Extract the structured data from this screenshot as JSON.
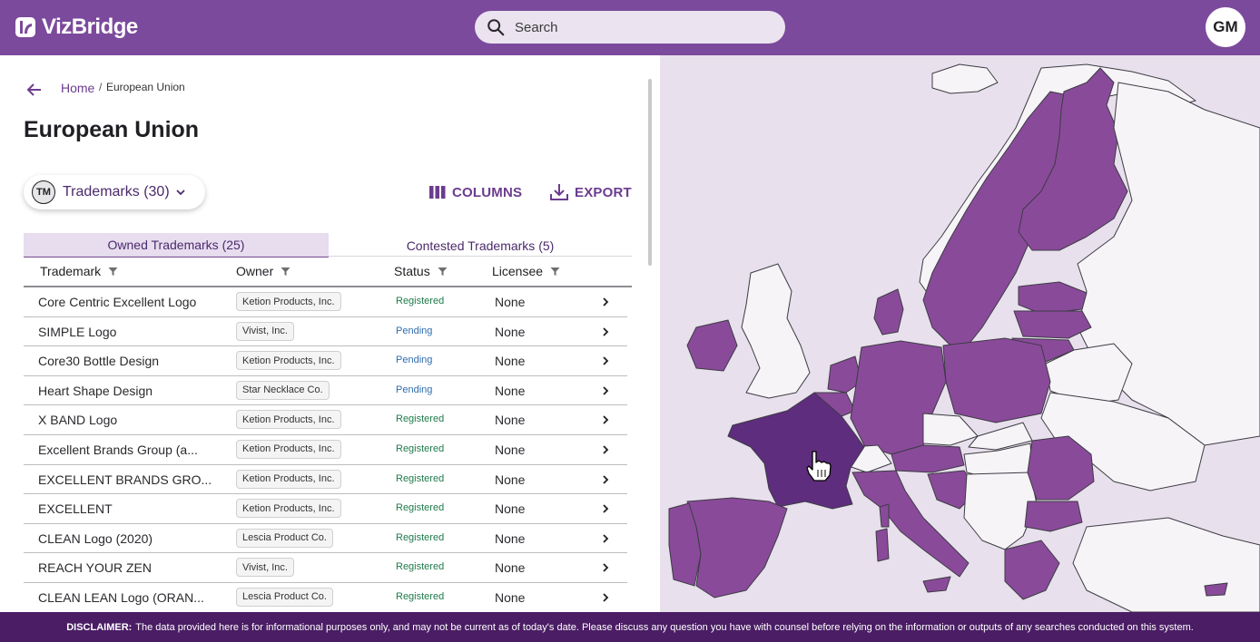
{
  "app": {
    "brand": "VizBridge",
    "user_initials": "GM"
  },
  "search": {
    "placeholder": "Search"
  },
  "breadcrumb": {
    "home": "Home",
    "separator": "/",
    "current": "European Union"
  },
  "page": {
    "title": "European Union"
  },
  "asset_selector": {
    "badge": "TM",
    "label": "Trademarks (30)"
  },
  "toolbar": {
    "columns_label": "COLUMNS",
    "export_label": "EXPORT"
  },
  "tabs": [
    {
      "label": "Owned Trademarks (25)",
      "active": true
    },
    {
      "label": "Contested Trademarks (5)",
      "active": false
    }
  ],
  "columns": [
    "Trademark",
    "Owner",
    "Status",
    "Licensee"
  ],
  "rows": [
    {
      "name": "Core Centric Excellent Logo",
      "owner": "Ketion Products, Inc.",
      "status": "Registered",
      "licensee": "None"
    },
    {
      "name": "SIMPLE Logo",
      "owner": "Vivist, Inc.",
      "status": "Pending",
      "licensee": "None"
    },
    {
      "name": "Core30 Bottle Design",
      "owner": "Ketion Products, Inc.",
      "status": "Pending",
      "licensee": "None"
    },
    {
      "name": "Heart Shape Design",
      "owner": "Star Necklace Co.",
      "status": "Pending",
      "licensee": "None"
    },
    {
      "name": "X BAND Logo",
      "owner": "Ketion Products, Inc.",
      "status": "Registered",
      "licensee": "None"
    },
    {
      "name": "Excellent Brands Group (a...",
      "owner": "Ketion Products, Inc.",
      "status": "Registered",
      "licensee": "None"
    },
    {
      "name": "EXCELLENT BRANDS GRO...",
      "owner": "Ketion Products, Inc.",
      "status": "Registered",
      "licensee": "None"
    },
    {
      "name": "EXCELLENT",
      "owner": "Ketion Products, Inc.",
      "status": "Registered",
      "licensee": "None"
    },
    {
      "name": "CLEAN Logo (2020)",
      "owner": "Lescia Product Co.",
      "status": "Registered",
      "licensee": "None"
    },
    {
      "name": "REACH YOUR ZEN",
      "owner": "Vivist, Inc.",
      "status": "Registered",
      "licensee": "None"
    },
    {
      "name": "CLEAN LEAN Logo (ORAN...",
      "owner": "Lescia Product Co.",
      "status": "Registered",
      "licensee": "None"
    }
  ],
  "map": {
    "highlighted_country": "France",
    "colors": {
      "sea": "#e8e0ec",
      "member": "#8a4a9a",
      "selected": "#5e2d7e",
      "non_member": "#f6f4f7",
      "border": "#3c3c44"
    }
  },
  "disclaimer": {
    "label": "DISCLAIMER:",
    "text": "The data provided here is for informational purposes only, and may not be current as of today's date. Please discuss any question you have with counsel before relying on the information or outputs of any searches conducted on this system."
  },
  "colors": {
    "brand": "#7b4a9c",
    "footer": "#4a1d64",
    "registered": "#1e7a4a",
    "pending": "#2f6cae"
  },
  "icons": {
    "logo": "vizbridge-logo-icon",
    "search": "search-icon",
    "back": "arrow-left-icon",
    "columns": "columns-icon",
    "export": "download-icon",
    "filter": "filter-icon",
    "row": "chevron-right-icon"
  }
}
